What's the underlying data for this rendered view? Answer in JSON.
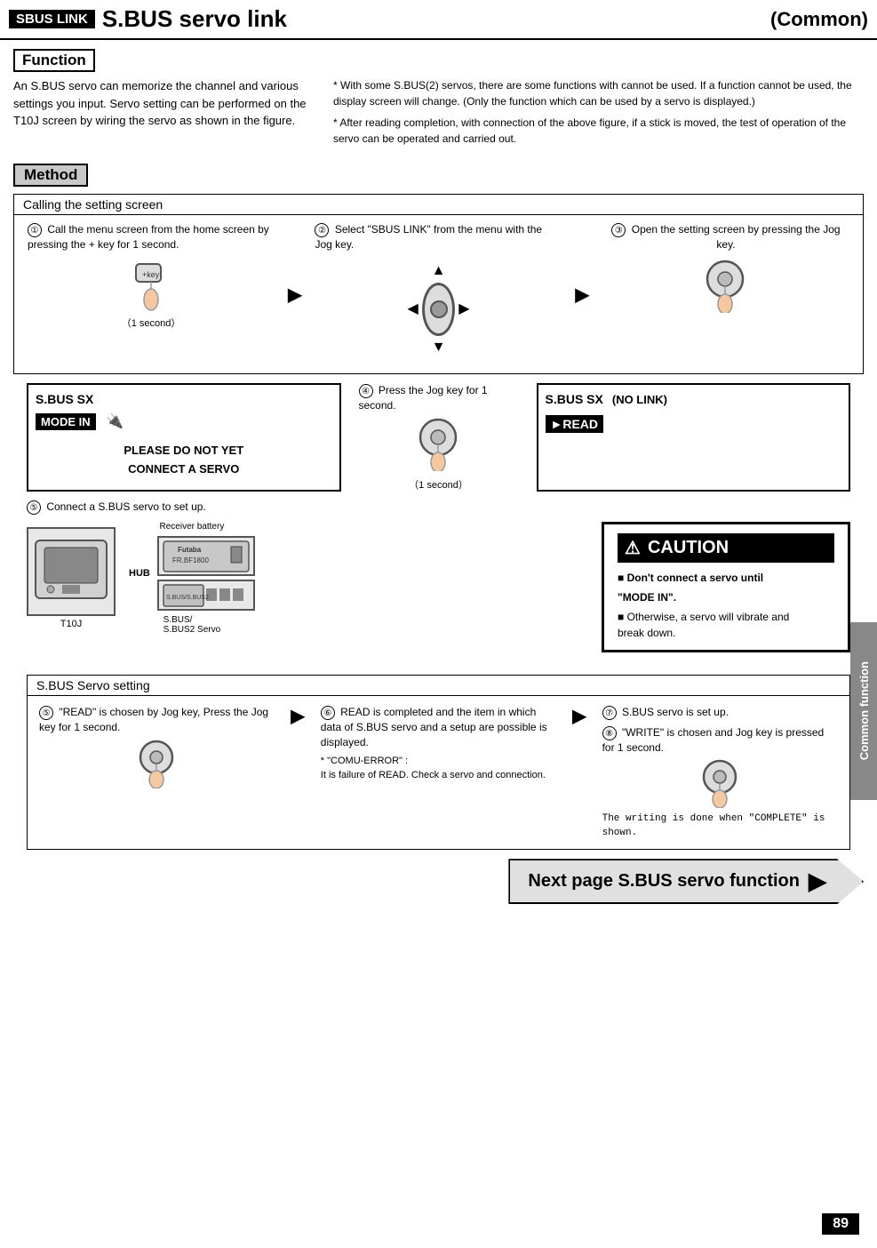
{
  "header": {
    "badge": "SBUS LINK",
    "title": "S.BUS servo link",
    "common": "(Common)"
  },
  "function": {
    "label": "Function",
    "left_text": "An S.BUS servo can memorize the channel and various settings you input.  Servo setting can be performed on the T10J screen by wiring the servo as shown in the figure.",
    "right_notes": [
      "* With some S.BUS(2) servos, there are some functions with cannot be used. If a function cannot be used, the display screen will change. (Only the function which can be used by a servo is displayed.)",
      "* After reading completion, with connection of the above figure, if a stick is moved, the test of operation of the servo can be operated and carried out."
    ]
  },
  "method": {
    "label": "Method",
    "calling_box": {
      "header": "Calling the setting screen",
      "step1": {
        "num": "①",
        "text": "Call the menu screen from the home screen by pressing the + key for 1 second.",
        "time_label": "（1 second）"
      },
      "step2": {
        "num": "②",
        "text": "Select  \"SBUS LINK\" from the menu with the Jog key."
      },
      "step3": {
        "num": "③",
        "text": "Open the setting screen by pressing the Jog key."
      }
    }
  },
  "display_panels": {
    "step4": {
      "num": "④",
      "text": "Press the Jog key for 1 second.",
      "time_label": "（1 second）"
    },
    "left_panel": {
      "title": "S.BUS   SX",
      "mode_badge": "MODE IN",
      "warning_line1": "PLEASE  DO  NOT  YET",
      "warning_line2": "CONNECT  A  SERVO"
    },
    "right_panel": {
      "title": "S.BUS   SX",
      "subtitle": "(NO   LINK)",
      "read_badge": "►READ"
    }
  },
  "connection": {
    "step5_num": "⑤",
    "step5_text": "Connect a S.BUS servo to set up.",
    "receiver_battery_label": "Receiver battery",
    "hub_label": "HUB",
    "sbus_label": "S.BUS/\nS.BUS2 Servo",
    "t10j_label": "T10J",
    "futaba_model": "FR.BF1800"
  },
  "caution": {
    "title": "⚠ CAUTION",
    "triangle": "⚠",
    "line1": "■ Don't connect a servo until",
    "line2": "\"MODE IN\".",
    "line3": "■ Otherwise, a servo will vibrate and",
    "line4": "break down."
  },
  "servo_setting": {
    "header": "S.BUS Servo setting",
    "step5": {
      "num": "⑤",
      "text": "\"READ\" is chosen by Jog key, Press the Jog key for 1 second."
    },
    "step6": {
      "num": "⑥",
      "text": "READ is completed and the item in which data of S.BUS servo and a setup are possible is displayed.",
      "note_header": "* \"COMU-ERROR\" :",
      "note_text": "It is failure of READ. Check a servo and connection."
    },
    "step7": {
      "num": "⑦",
      "text": "S.BUS servo is set up."
    },
    "step8": {
      "num": "⑧",
      "text": "\"WRITE\" is chosen and Jog key is pressed for 1 second.",
      "writing_text": "The writing is done when \"COMPLETE\" is shown."
    }
  },
  "next_page": {
    "text": "Next page S.BUS servo function"
  },
  "page_number": "89",
  "side_tab": "Common function"
}
